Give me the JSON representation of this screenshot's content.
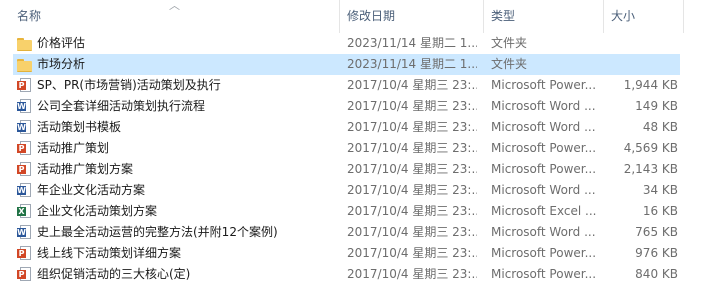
{
  "columns": {
    "name": "名称",
    "date": "修改日期",
    "type": "类型",
    "size": "大小"
  },
  "rows": [
    {
      "icon": "folder",
      "name": "价格评估",
      "date": "2023/11/14 星期二 1...",
      "type": "文件夹",
      "size": ""
    },
    {
      "icon": "folder",
      "name": "市场分析",
      "date": "2023/11/14 星期二 1...",
      "type": "文件夹",
      "size": "",
      "selected": true
    },
    {
      "icon": "ppt",
      "name": "SP、PR(市场营销)活动策划及执行",
      "date": "2017/10/4 星期三 23:...",
      "type": "Microsoft Power...",
      "size": "1,944 KB"
    },
    {
      "icon": "word",
      "name": "公司全套详细活动策划执行流程",
      "date": "2017/10/4 星期三 23:...",
      "type": "Microsoft Word ...",
      "size": "149 KB"
    },
    {
      "icon": "word",
      "name": "活动策划书模板",
      "date": "2017/10/4 星期三 23:...",
      "type": "Microsoft Word ...",
      "size": "48 KB"
    },
    {
      "icon": "ppt",
      "name": "活动推广策划",
      "date": "2017/10/4 星期三 23:...",
      "type": "Microsoft Power...",
      "size": "4,569 KB"
    },
    {
      "icon": "ppt",
      "name": "活动推广策划方案",
      "date": "2017/10/4 星期三 23:...",
      "type": "Microsoft Power...",
      "size": "2,143 KB"
    },
    {
      "icon": "word",
      "name": "年企业文化活动方案",
      "date": "2017/10/4 星期三 23:...",
      "type": "Microsoft Word ...",
      "size": "34 KB"
    },
    {
      "icon": "excel",
      "name": "企业文化活动策划方案",
      "date": "2017/10/4 星期三 23:...",
      "type": "Microsoft Excel ...",
      "size": "16 KB"
    },
    {
      "icon": "word",
      "name": "史上最全活动运营的完整方法(并附12个案例)",
      "date": "2017/10/4 星期三 23:...",
      "type": "Microsoft Word ...",
      "size": "765 KB"
    },
    {
      "icon": "ppt",
      "name": "线上线下活动策划详细方案",
      "date": "2017/10/4 星期三 23:...",
      "type": "Microsoft Power...",
      "size": "976 KB"
    },
    {
      "icon": "ppt",
      "name": "组织促销活动的三大核心(定)",
      "date": "2017/10/4 星期三 23:...",
      "type": "Microsoft Power...",
      "size": "840 KB"
    }
  ]
}
